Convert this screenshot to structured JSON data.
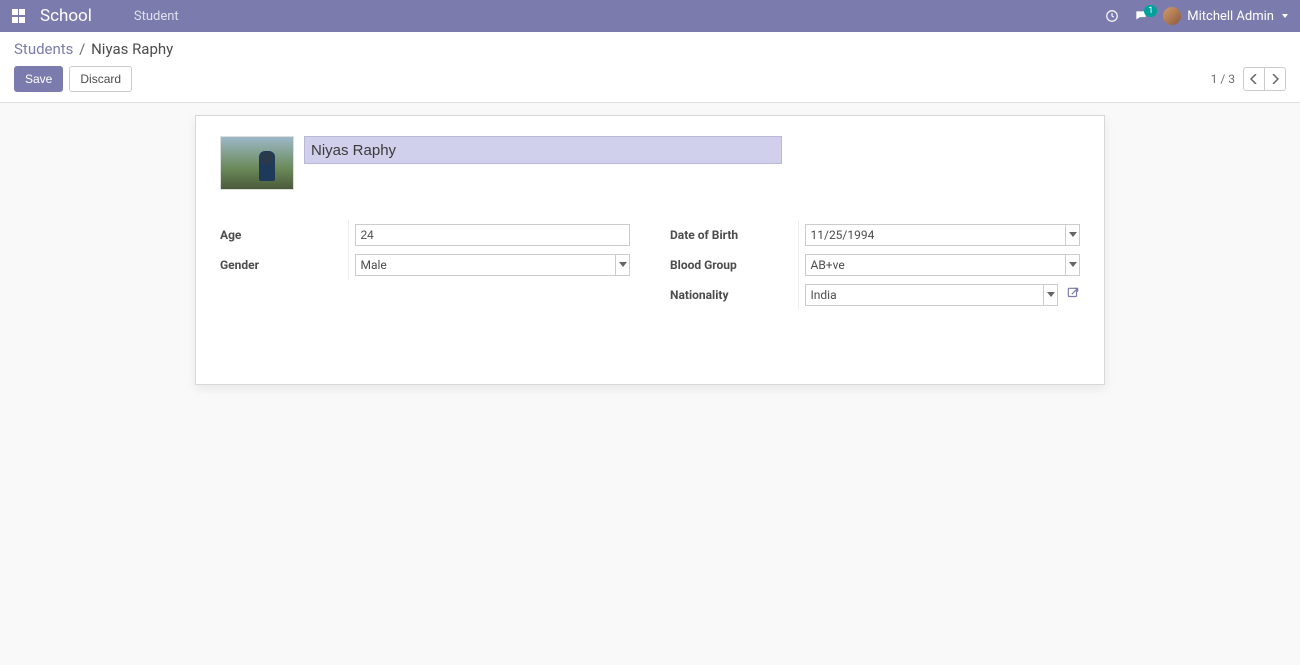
{
  "navbar": {
    "brand": "School",
    "menu_item": "Student",
    "chat_badge": "1",
    "user_name": "Mitchell Admin"
  },
  "breadcrumb": {
    "root": "Students",
    "current": "Niyas Raphy"
  },
  "actions": {
    "save": "Save",
    "discard": "Discard"
  },
  "pager": {
    "text": "1 / 3"
  },
  "form": {
    "name_value": "Niyas Raphy",
    "left": {
      "age_label": "Age",
      "age_value": "24",
      "gender_label": "Gender",
      "gender_value": "Male"
    },
    "right": {
      "dob_label": "Date of Birth",
      "dob_value": "11/25/1994",
      "blood_label": "Blood Group",
      "blood_value": "AB+ve",
      "nationality_label": "Nationality",
      "nationality_value": "India"
    }
  }
}
